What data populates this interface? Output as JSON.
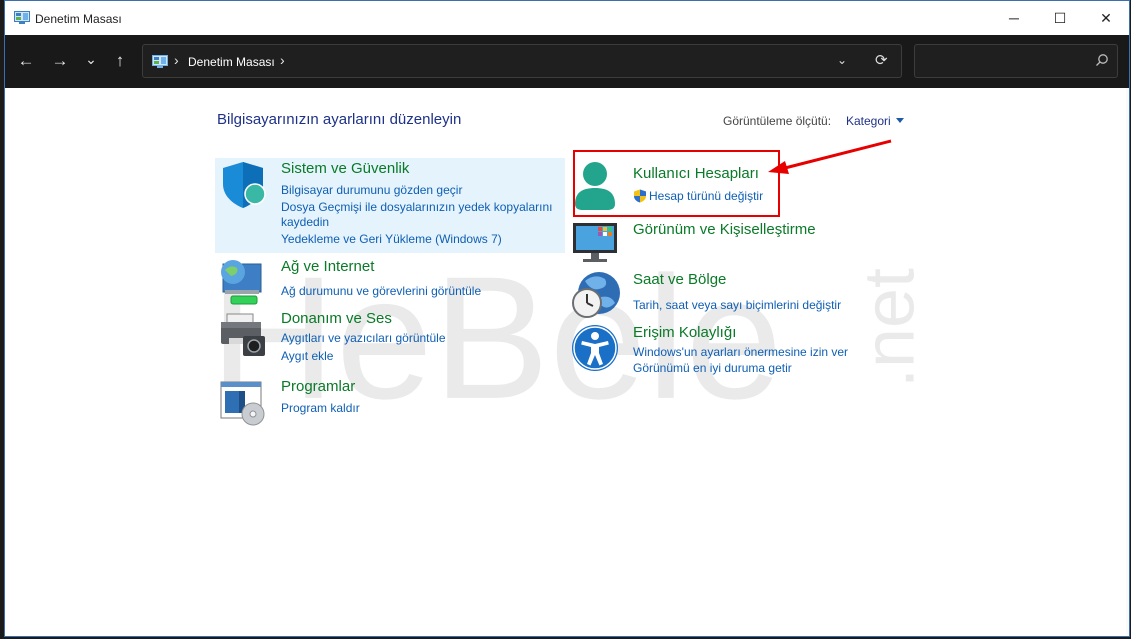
{
  "window": {
    "title": "Denetim Masası"
  },
  "titlebar": {
    "minimize": "─",
    "maximize": "☐",
    "close": "✕"
  },
  "nav": {
    "back": "←",
    "forward": "→",
    "recent": "⌄",
    "up": "↑"
  },
  "address": {
    "separator": "›",
    "crumb": "Denetim Masası",
    "dropdown": "⌄",
    "refresh": "⟳"
  },
  "search": {
    "placeholder": "",
    "icon": "search-icon"
  },
  "main": {
    "heading": "Bilgisayarınızın ayarlarını düzenleyin",
    "view_by_label": "Görüntüleme ölçütü:",
    "view_by_value": "Kategori"
  },
  "left_categories": [
    {
      "title": "Sistem ve Güvenlik",
      "links": [
        "Bilgisayar durumunu gözden geçir",
        "Dosya Geçmişi ile dosyalarınızın yedek kopyalarını",
        "kaydedin",
        "Yedekleme ve Geri Yükleme (Windows 7)"
      ]
    },
    {
      "title": "Ağ ve Internet",
      "links": [
        "Ağ durumunu ve görevlerini görüntüle"
      ]
    },
    {
      "title": "Donanım ve Ses",
      "links": [
        "Aygıtları ve yazıcıları görüntüle",
        "Aygıt ekle"
      ]
    },
    {
      "title": "Programlar",
      "links": [
        "Program kaldır"
      ]
    }
  ],
  "right_categories": [
    {
      "title": "Kullanıcı Hesapları",
      "links": [
        "Hesap türünü değiştir"
      ]
    },
    {
      "title": "Görünüm ve Kişiselleştirme",
      "links": []
    },
    {
      "title": "Saat ve Bölge",
      "links": [
        "Tarih, saat veya sayı biçimlerini değiştir"
      ]
    },
    {
      "title": "Erişim Kolaylığı",
      "links": [
        "Windows'un ayarları önermesine izin ver",
        "Görünümü en iyi duruma getir"
      ]
    }
  ],
  "watermark": {
    "text": "HeBele",
    "suffix": ".net"
  },
  "colors": {
    "category_title": "#0a7a28",
    "link": "#0f5fb4",
    "heading": "#1e3287",
    "annotation": "#e60000",
    "highlight": "#e5f3fc"
  }
}
